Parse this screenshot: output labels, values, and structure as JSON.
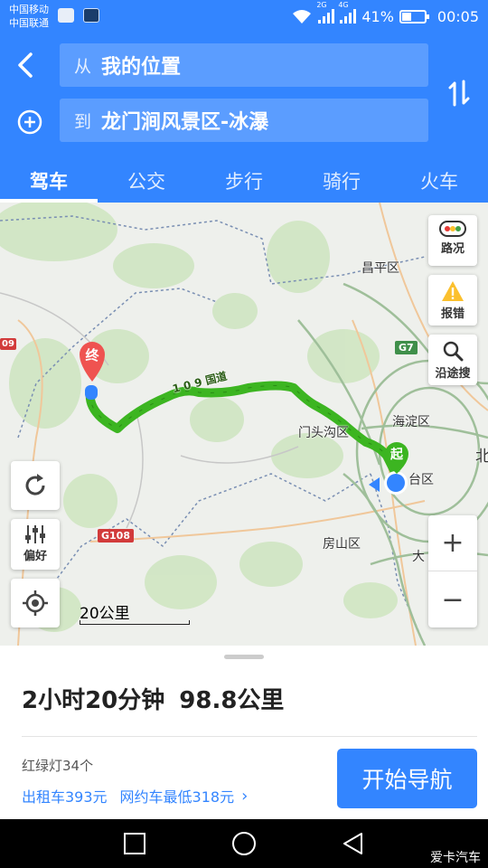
{
  "status_bar": {
    "carrier_1": "中国移动",
    "carrier_2": "中国联通",
    "network_label": "2G",
    "network_label_2": "4G",
    "battery_level_percent": 41,
    "battery_text": "41%",
    "time": "00:05"
  },
  "header": {
    "from_prefix": "从",
    "from_value": "我的位置",
    "to_prefix": "到",
    "to_value": "龙门涧风景区-冰瀑",
    "tabs": [
      {
        "label": "驾车",
        "active": true
      },
      {
        "label": "公交",
        "active": false
      },
      {
        "label": "步行",
        "active": false
      },
      {
        "label": "骑行",
        "active": false
      },
      {
        "label": "火车",
        "active": false
      }
    ]
  },
  "map": {
    "labels": {
      "changping": "昌平区",
      "haidian": "海淀区",
      "mentougou": "门头沟区",
      "fengtai_partial": "台区",
      "fangshan": "房山区",
      "beijing_partial": "北",
      "daxing_partial": "大"
    },
    "road_badges": {
      "g7": "G7",
      "g108": "G108",
      "left_edge": "09"
    },
    "route_label": "1 0 9 国道",
    "end_marker": "终",
    "start_marker": "起",
    "scale_text": "20公里",
    "tools": {
      "traffic": "路况",
      "report": "报错",
      "search_along": "沿途搜",
      "prefer": "偏好",
      "zoom_in": "+",
      "zoom_out": "−"
    },
    "route_color": "#3cb521",
    "accent_color": "#3385ff"
  },
  "panel": {
    "duration": "2小时20分钟",
    "distance": "98.8公里",
    "traffic_lights": "红绿灯34个",
    "taxi_fare": "出租车393元",
    "ride_hailing_fare": "网约车最低318元",
    "start_button": "开始导航"
  },
  "watermark": "爱卡汽车"
}
